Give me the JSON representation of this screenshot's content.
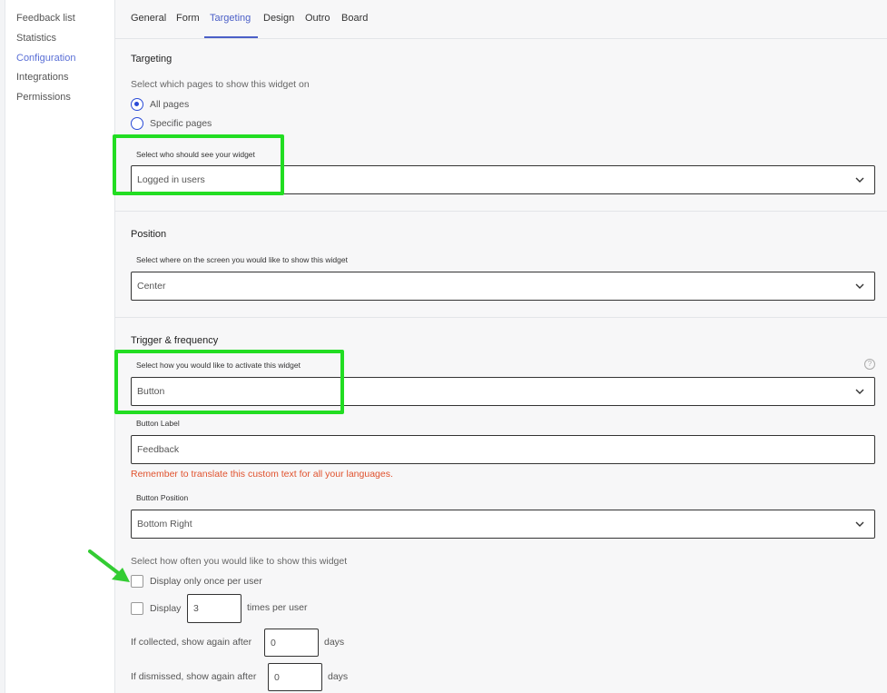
{
  "sidebar": {
    "items": [
      {
        "label": "Feedback list"
      },
      {
        "label": "Statistics"
      },
      {
        "label": "Configuration"
      },
      {
        "label": "Integrations"
      },
      {
        "label": "Permissions"
      }
    ],
    "active": "Configuration"
  },
  "tabs": {
    "items": [
      {
        "label": "General"
      },
      {
        "label": "Form"
      },
      {
        "label": "Targeting"
      },
      {
        "label": "Design"
      },
      {
        "label": "Outro"
      },
      {
        "label": "Board"
      }
    ],
    "active": "Targeting"
  },
  "targeting": {
    "title": "Targeting",
    "pages_hint": "Select which pages to show this widget on",
    "radio_all": "All pages",
    "radio_specific": "Specific pages",
    "selected_radio": "All pages",
    "who_label": "Select who should see your widget",
    "who_value": "Logged in users"
  },
  "position": {
    "title": "Position",
    "label": "Select where on the screen you would like to show this widget",
    "value": "Center"
  },
  "trigger": {
    "title": "Trigger & frequency",
    "activate_label": "Select how you would like to activate this widget",
    "activate_value": "Button",
    "help_icon_glyph": "?",
    "button_label_label": "Button Label",
    "button_label_value": "Feedback",
    "translate_warning": "Remember to translate this custom text for all your languages.",
    "button_position_label": "Button Position",
    "button_position_value": "Bottom Right",
    "frequency_hint": "Select how often you would like to show this widget",
    "once_label": "Display only once per user",
    "display_prefix": "Display",
    "display_times_value": "3",
    "display_suffix": "times per user",
    "collected_prefix": "If collected, show again after",
    "collected_value": "0",
    "collected_suffix": "days",
    "dismissed_prefix": "If dismissed, show again after",
    "dismissed_value": "0",
    "dismissed_suffix": "days"
  },
  "colors": {
    "accent": "#4b5fc7",
    "radio": "#2a4bd7",
    "warning": "#e0522e",
    "annotation_box": "#22dd22",
    "annotation_arrow": "#33cc33"
  },
  "icons": {
    "select_chevron": "chevron-down-icon",
    "help": "help-icon",
    "annotation_arrow": "arrow-icon"
  }
}
